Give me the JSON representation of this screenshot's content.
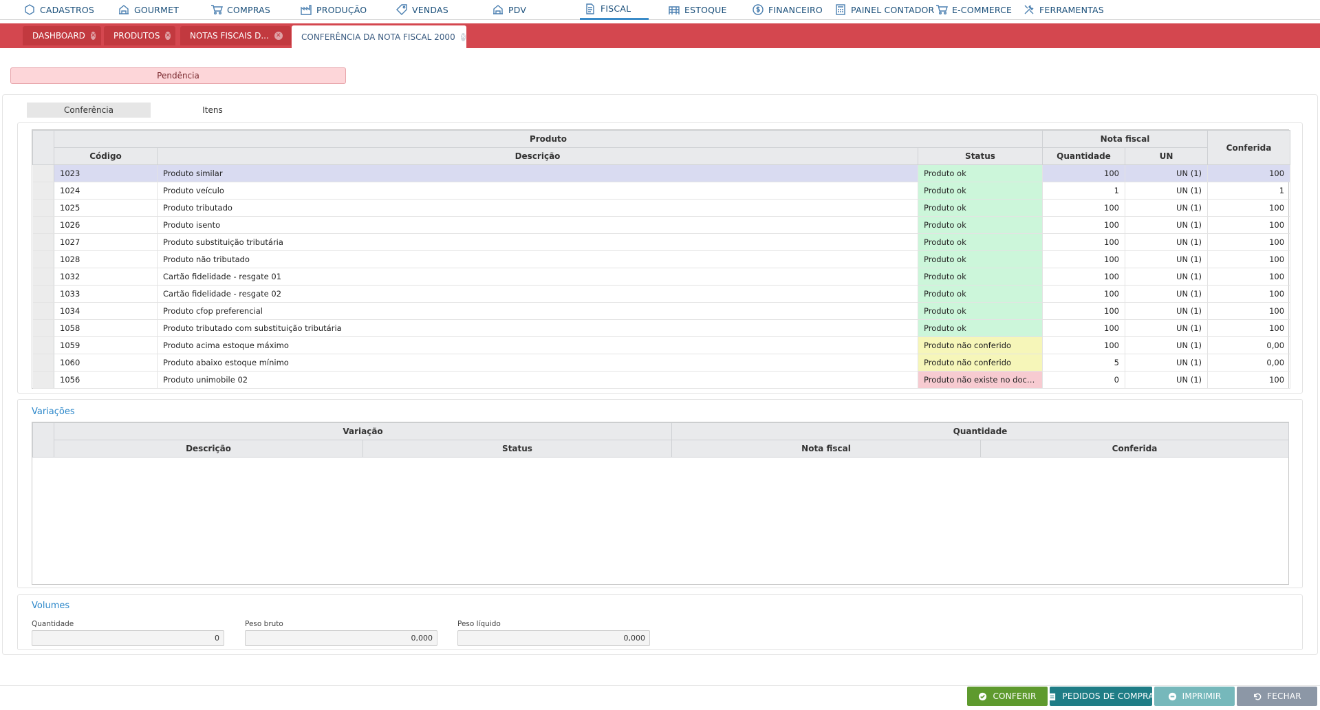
{
  "menu": [
    {
      "label": "CADASTROS",
      "icon": "hexagon-icon"
    },
    {
      "label": "GOURMET",
      "icon": "building-icon"
    },
    {
      "label": "COMPRAS",
      "icon": "cart-icon"
    },
    {
      "label": "PRODUÇÃO",
      "icon": "factory-icon"
    },
    {
      "label": "VENDAS",
      "icon": "tag-icon"
    },
    {
      "label": "PDV",
      "icon": "building-icon"
    },
    {
      "label": "FISCAL",
      "icon": "document-icon"
    },
    {
      "label": "ESTOQUE",
      "icon": "warehouse-icon"
    },
    {
      "label": "FINANCEIRO",
      "icon": "dollar-icon"
    },
    {
      "label": "PAINEL CONTADOR",
      "icon": "calculator-icon"
    },
    {
      "label": "E-COMMERCE",
      "icon": "cart-icon"
    },
    {
      "label": "FERRAMENTAS",
      "icon": "tools-icon"
    }
  ],
  "tabs": [
    {
      "label": "DASHBOARD"
    },
    {
      "label": "PRODUTOS"
    },
    {
      "label": "NOTAS FISCAIS D..."
    },
    {
      "label": "CONFERÊNCIA DA NOTA FISCAL 2000"
    }
  ],
  "pendencia": "Pendência",
  "subtabs": {
    "conferencia": "Conferência",
    "itens": "Itens"
  },
  "products_table": {
    "group_produto": "Produto",
    "group_nota": "Nota fiscal",
    "col_conferida": "Conferida",
    "col_codigo": "Código",
    "col_descricao": "Descrição",
    "col_status": "Status",
    "col_quantidade": "Quantidade",
    "col_un": "UN",
    "rows": [
      {
        "codigo": "1023",
        "descricao": "Produto similar",
        "status": "Produto ok",
        "status_type": "ok",
        "quantidade": "100",
        "un": "UN (1)",
        "conferida": "100"
      },
      {
        "codigo": "1024",
        "descricao": "Produto veículo",
        "status": "Produto ok",
        "status_type": "ok",
        "quantidade": "1",
        "un": "UN (1)",
        "conferida": "1"
      },
      {
        "codigo": "1025",
        "descricao": "Produto tributado",
        "status": "Produto ok",
        "status_type": "ok",
        "quantidade": "100",
        "un": "UN (1)",
        "conferida": "100"
      },
      {
        "codigo": "1026",
        "descricao": "Produto isento",
        "status": "Produto ok",
        "status_type": "ok",
        "quantidade": "100",
        "un": "UN (1)",
        "conferida": "100"
      },
      {
        "codigo": "1027",
        "descricao": "Produto substituição tributária",
        "status": "Produto ok",
        "status_type": "ok",
        "quantidade": "100",
        "un": "UN (1)",
        "conferida": "100"
      },
      {
        "codigo": "1028",
        "descricao": "Produto não tributado",
        "status": "Produto ok",
        "status_type": "ok",
        "quantidade": "100",
        "un": "UN (1)",
        "conferida": "100"
      },
      {
        "codigo": "1032",
        "descricao": "Cartão fidelidade - resgate 01",
        "status": "Produto ok",
        "status_type": "ok",
        "quantidade": "100",
        "un": "UN (1)",
        "conferida": "100"
      },
      {
        "codigo": "1033",
        "descricao": "Cartão fidelidade - resgate 02",
        "status": "Produto ok",
        "status_type": "ok",
        "quantidade": "100",
        "un": "UN (1)",
        "conferida": "100"
      },
      {
        "codigo": "1034",
        "descricao": "Produto cfop preferencial",
        "status": "Produto ok",
        "status_type": "ok",
        "quantidade": "100",
        "un": "UN (1)",
        "conferida": "100"
      },
      {
        "codigo": "1058",
        "descricao": "Produto tributado com substituição tributária",
        "status": "Produto ok",
        "status_type": "ok",
        "quantidade": "100",
        "un": "UN (1)",
        "conferida": "100"
      },
      {
        "codigo": "1059",
        "descricao": "Produto acima estoque máximo",
        "status": "Produto não conferido",
        "status_type": "warn",
        "quantidade": "100",
        "un": "UN (1)",
        "conferida": "0,00"
      },
      {
        "codigo": "1060",
        "descricao": "Produto abaixo estoque mínimo",
        "status": "Produto não conferido",
        "status_type": "warn",
        "quantidade": "5",
        "un": "UN (1)",
        "conferida": "0,00"
      },
      {
        "codigo": "1056",
        "descricao": "Produto unimobile 02",
        "status": "Produto não existe no docu...",
        "status_type": "err",
        "quantidade": "0",
        "un": "UN (1)",
        "conferida": "100"
      }
    ]
  },
  "variacoes": {
    "title": "Variações",
    "group_variacao": "Variação",
    "group_quantidade": "Quantidade",
    "col_descricao": "Descrição",
    "col_status": "Status",
    "col_nota": "Nota fiscal",
    "col_conferida": "Conferida"
  },
  "volumes": {
    "title": "Volumes",
    "quantidade_label": "Quantidade",
    "quantidade_value": "0",
    "peso_bruto_label": "Peso bruto",
    "peso_bruto_value": "0,000",
    "peso_liquido_label": "Peso líquido",
    "peso_liquido_value": "0,000"
  },
  "buttons": {
    "conferir": "CONFERIR",
    "pedidos": "PEDIDOS DE COMPRA",
    "imprimir": "IMPRIMIR",
    "fechar": "FECHAR"
  },
  "colors": {
    "tabbar": "#d4474f",
    "status_ok": "#ccf6da",
    "status_warn": "#f6f6b9",
    "status_err": "#f7cbd1",
    "btn_conferir": "#5e9a2e",
    "btn_pedidos": "#1f7d86",
    "btn_imprimir": "#76b8bb",
    "btn_fechar": "#8c97a6"
  }
}
